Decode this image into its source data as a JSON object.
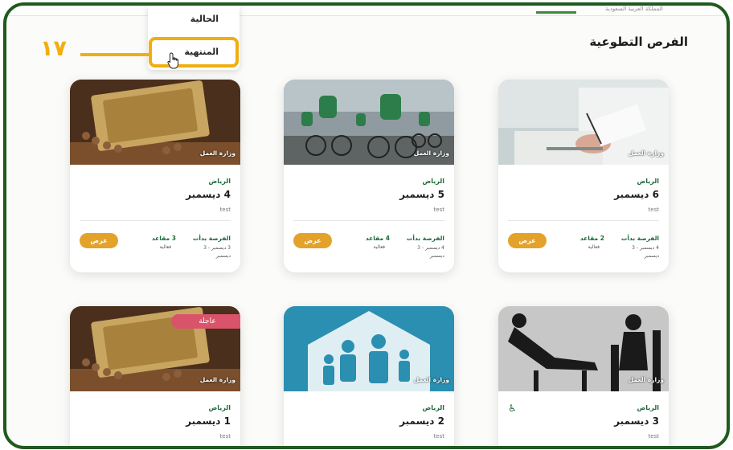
{
  "top_bar": {
    "ministry_text": "المملكة العربية السعودية"
  },
  "page_title": "الفرص التطوعية",
  "dropdown": {
    "items": [
      "الحالية",
      "المنتهية"
    ]
  },
  "callout_number": "١٧",
  "cards": [
    {
      "city": "الرياض",
      "date": "6 ديسمبر",
      "desc": "test",
      "tag": "وزارة العمل",
      "started": "الفرصة بدأت",
      "period": "4 ديسمبر - 3 ديسمبر",
      "seats": "2 مقاعد",
      "seats_type": "فعالية",
      "view": "عرض"
    },
    {
      "city": "الرياض",
      "date": "5 ديسمبر",
      "desc": "test",
      "tag": "وزارة العمل",
      "started": "الفرصة بدأت",
      "period": "4 ديسمبر - 3 ديسمبر",
      "seats": "4 مقاعد",
      "seats_type": "فعالية",
      "view": "عرض"
    },
    {
      "city": "الرياض",
      "date": "4 ديسمبر",
      "desc": "test",
      "tag": "وزارة العمل",
      "started": "الفرصة بدأت",
      "period": "3 ديسمبر - 3 ديسمبر",
      "seats": "3 مقاعد",
      "seats_type": "فعالية",
      "view": "عرض"
    },
    {
      "city": "الرياض",
      "date": "3 ديسمبر",
      "desc": "test",
      "tag": "وزارة العمل"
    },
    {
      "city": "الرياض",
      "date": "2 ديسمبر",
      "desc": "test",
      "tag": "وزارة العمل"
    },
    {
      "city": "الرياض",
      "date": "1 ديسمبر",
      "desc": "test",
      "tag": "وزارة العمل",
      "urgent": "عاجلة"
    }
  ],
  "colors": {
    "frame": "#1f5a1e",
    "accent": "#f0ae10",
    "button": "#e3a32b",
    "green_text": "#1f6b3a",
    "urgent": "#d9546a"
  }
}
